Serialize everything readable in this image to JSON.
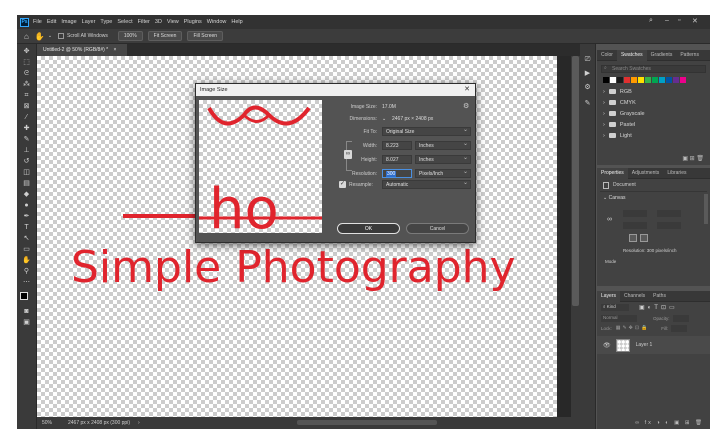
{
  "app": {
    "logo": "Ps"
  },
  "menu": [
    "File",
    "Edit",
    "Image",
    "Layer",
    "Type",
    "Select",
    "Filter",
    "3D",
    "View",
    "Plugins",
    "Window",
    "Help"
  ],
  "options": {
    "scroll_all": "Scroll All Windows",
    "zoom": "100%",
    "fit_screen": "Fit Screen",
    "fill_screen": "Fill Screen"
  },
  "document": {
    "tab": "Untitled-2 @ 50% (RGB/8#) *",
    "text": "Simple Photography"
  },
  "status": {
    "zoom": "50%",
    "size": "2467 px x 2408 px (300 ppi)"
  },
  "dialog": {
    "title": "Image Size",
    "image_size_label": "Image Size:",
    "image_size_value": "17.0M",
    "dimensions_label": "Dimensions:",
    "dimensions_value": "2467 px  ×  2408 px",
    "fit_to_label": "Fit To:",
    "fit_to_value": "Original Size",
    "width_label": "Width:",
    "width_value": "8.223",
    "width_unit": "Inches",
    "height_label": "Height:",
    "height_value": "8.027",
    "height_unit": "Inches",
    "resolution_label": "Resolution:",
    "resolution_value": "300",
    "resolution_unit": "Pixels/Inch",
    "resample_label": "Resample:",
    "resample_value": "Automatic",
    "ok": "OK",
    "cancel": "Cancel",
    "preview_text": "ho"
  },
  "panels": {
    "swatches_tabs": [
      "Color",
      "Swatches",
      "Gradients",
      "Patterns"
    ],
    "search_placeholder": "Search Swatches",
    "swatch_colors": [
      "#000000",
      "#ffffff",
      "#1a1a1a",
      "#e03030",
      "#ff9a00",
      "#ffe000",
      "#36b34a",
      "#00a651",
      "#00a0c6",
      "#0054a6",
      "#662d91",
      "#ec008c"
    ],
    "folders": [
      "RGB",
      "CMYK",
      "Grayscale",
      "Pastel",
      "Light"
    ],
    "props_tabs": [
      "Properties",
      "Adjustments",
      "Libraries"
    ],
    "props_doc": "Document",
    "canvas_label": "Canvas",
    "resolution_text": "Resolution: 300 pixels/inch",
    "mode_label": "Mode",
    "layers_tabs": [
      "Layers",
      "Channels",
      "Paths"
    ],
    "kind": "Kind",
    "normal": "Normal",
    "opacity": "Opacity:",
    "lock": "Lock:",
    "fill": "Fill:",
    "layer_name": "Layer 1"
  }
}
